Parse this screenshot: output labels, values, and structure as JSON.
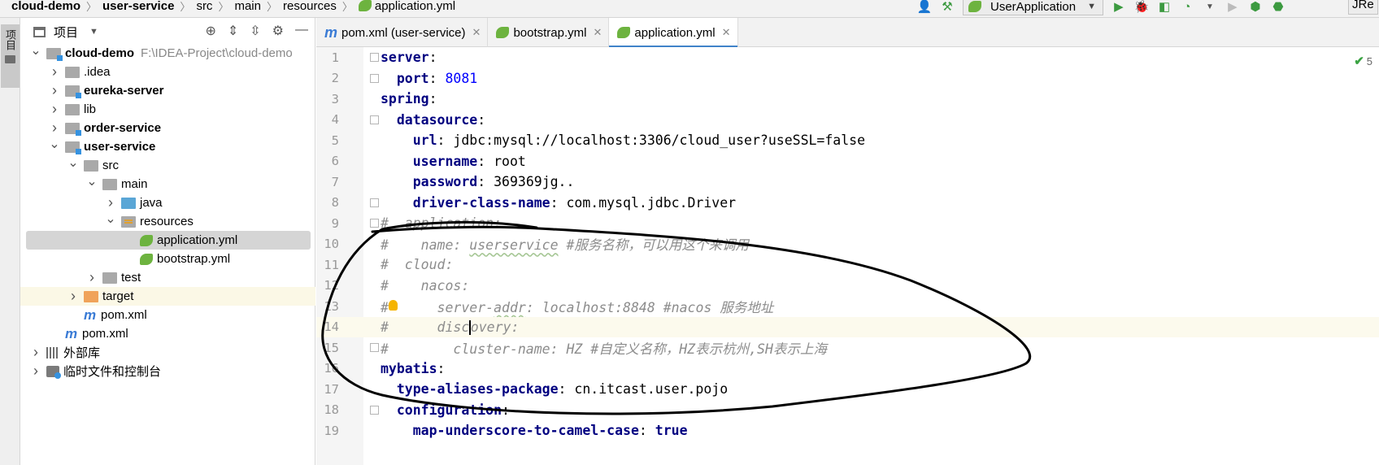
{
  "breadcrumbs": [
    {
      "label": "cloud-demo",
      "bold": true
    },
    {
      "label": "user-service",
      "bold": true
    },
    {
      "label": "src",
      "bold": false
    },
    {
      "label": "main",
      "bold": false
    },
    {
      "label": "resources",
      "bold": false
    },
    {
      "label": "application.yml",
      "bold": false
    }
  ],
  "toolbar": {
    "run_config": "UserApplication",
    "jre_label": "JRe"
  },
  "left_strip": {
    "project_tab": "项目"
  },
  "project_panel": {
    "title": "项目",
    "tree": [
      {
        "label": "cloud-demo",
        "path": "F:\\IDEA-Project\\cloud-demo",
        "bold": true,
        "indent": 0,
        "arrow": "open",
        "icon": "module"
      },
      {
        "label": ".idea",
        "bold": false,
        "indent": 1,
        "arrow": "closed",
        "icon": "folder"
      },
      {
        "label": "eureka-server",
        "bold": true,
        "indent": 1,
        "arrow": "closed",
        "icon": "module"
      },
      {
        "label": "lib",
        "bold": false,
        "indent": 1,
        "arrow": "closed",
        "icon": "folder"
      },
      {
        "label": "order-service",
        "bold": true,
        "indent": 1,
        "arrow": "closed",
        "icon": "module"
      },
      {
        "label": "user-service",
        "bold": true,
        "indent": 1,
        "arrow": "open",
        "icon": "module"
      },
      {
        "label": "src",
        "bold": false,
        "indent": 2,
        "arrow": "open",
        "icon": "folder"
      },
      {
        "label": "main",
        "bold": false,
        "indent": 3,
        "arrow": "open",
        "icon": "folder"
      },
      {
        "label": "java",
        "bold": false,
        "indent": 4,
        "arrow": "closed",
        "icon": "folder-blue"
      },
      {
        "label": "resources",
        "bold": false,
        "indent": 4,
        "arrow": "open",
        "icon": "folder-res"
      },
      {
        "label": "application.yml",
        "bold": false,
        "indent": 5,
        "arrow": "none",
        "icon": "spring",
        "selected": true
      },
      {
        "label": "bootstrap.yml",
        "bold": false,
        "indent": 5,
        "arrow": "none",
        "icon": "spring"
      },
      {
        "label": "test",
        "bold": false,
        "indent": 3,
        "arrow": "closed",
        "icon": "folder"
      },
      {
        "label": "target",
        "bold": false,
        "indent": 2,
        "arrow": "closed",
        "icon": "folder-orange",
        "highlight": true
      },
      {
        "label": "pom.xml",
        "bold": false,
        "indent": 2,
        "arrow": "none",
        "icon": "maven"
      },
      {
        "label": "pom.xml",
        "bold": false,
        "indent": 1,
        "arrow": "none",
        "icon": "maven"
      },
      {
        "label": "外部库",
        "bold": false,
        "indent": 0,
        "arrow": "closed",
        "icon": "library"
      },
      {
        "label": "临时文件和控制台",
        "bold": false,
        "indent": 0,
        "arrow": "closed",
        "icon": "scratch"
      }
    ]
  },
  "editor_tabs": [
    {
      "label": "pom.xml (user-service)",
      "icon": "maven",
      "active": false
    },
    {
      "label": "bootstrap.yml",
      "icon": "spring",
      "active": false
    },
    {
      "label": "application.yml",
      "icon": "spring",
      "active": true
    }
  ],
  "editor": {
    "inspection_count": "5",
    "current_line": 14,
    "lines": [
      {
        "n": "1",
        "parts": [
          {
            "t": "server",
            "c": "key"
          },
          {
            "t": ":",
            "c": "val"
          }
        ]
      },
      {
        "n": "2",
        "parts": [
          {
            "t": "  port",
            "c": "key"
          },
          {
            "t": ": ",
            "c": "val"
          },
          {
            "t": "8081",
            "c": "num"
          }
        ]
      },
      {
        "n": "3",
        "parts": [
          {
            "t": "spring",
            "c": "key"
          },
          {
            "t": ":",
            "c": "val"
          }
        ]
      },
      {
        "n": "4",
        "parts": [
          {
            "t": "  datasource",
            "c": "key"
          },
          {
            "t": ":",
            "c": "val"
          }
        ]
      },
      {
        "n": "5",
        "parts": [
          {
            "t": "    url",
            "c": "key"
          },
          {
            "t": ": jdbc:mysql://localhost:3306/cloud_user?useSSL=false",
            "c": "val"
          }
        ]
      },
      {
        "n": "6",
        "parts": [
          {
            "t": "    username",
            "c": "key"
          },
          {
            "t": ": root",
            "c": "val"
          }
        ]
      },
      {
        "n": "7",
        "parts": [
          {
            "t": "    password",
            "c": "key"
          },
          {
            "t": ": 369369jg..",
            "c": "val"
          }
        ]
      },
      {
        "n": "8",
        "parts": [
          {
            "t": "    driver-class-name",
            "c": "key"
          },
          {
            "t": ": com.mysql.jdbc.Driver",
            "c": "val"
          }
        ]
      },
      {
        "n": "9",
        "parts": [
          {
            "t": "#  application:",
            "c": "cmt"
          }
        ]
      },
      {
        "n": "10",
        "parts": [
          {
            "t": "#    name: ",
            "c": "cmt"
          },
          {
            "t": "userservice",
            "c": "cmtu"
          },
          {
            "t": " #服务名称，可以用这个来调用",
            "c": "cmt"
          }
        ]
      },
      {
        "n": "11",
        "parts": [
          {
            "t": "#  cloud:",
            "c": "cmt"
          }
        ]
      },
      {
        "n": "12",
        "parts": [
          {
            "t": "#    nacos:",
            "c": "cmt"
          }
        ]
      },
      {
        "n": "13",
        "parts": [
          {
            "t": "#      server-",
            "c": "cmt"
          },
          {
            "t": "addr",
            "c": "cmtu"
          },
          {
            "t": ": localhost:8848 #nacos 服务地址",
            "c": "cmt"
          }
        ]
      },
      {
        "n": "14",
        "parts": [
          {
            "t": "#      disc",
            "c": "cmt"
          },
          {
            "t": "|",
            "c": "caret"
          },
          {
            "t": "overy:",
            "c": "cmt"
          }
        ]
      },
      {
        "n": "15",
        "parts": [
          {
            "t": "#        cluster-name: HZ #自定义名称，HZ表示杭州,SH表示上海",
            "c": "cmt"
          }
        ]
      },
      {
        "n": "16",
        "parts": [
          {
            "t": "mybatis",
            "c": "key"
          },
          {
            "t": ":",
            "c": "val"
          }
        ]
      },
      {
        "n": "17",
        "parts": [
          {
            "t": "  type-aliases-package",
            "c": "key"
          },
          {
            "t": ": cn.itcast.user.pojo",
            "c": "val"
          }
        ]
      },
      {
        "n": "18",
        "parts": [
          {
            "t": "  configuration",
            "c": "key"
          },
          {
            "t": ":",
            "c": "val"
          }
        ]
      },
      {
        "n": "19",
        "parts": [
          {
            "t": "    map-underscore-to-camel-case",
            "c": "key"
          },
          {
            "t": ": ",
            "c": "val"
          },
          {
            "t": "true",
            "c": "key"
          }
        ]
      }
    ]
  }
}
